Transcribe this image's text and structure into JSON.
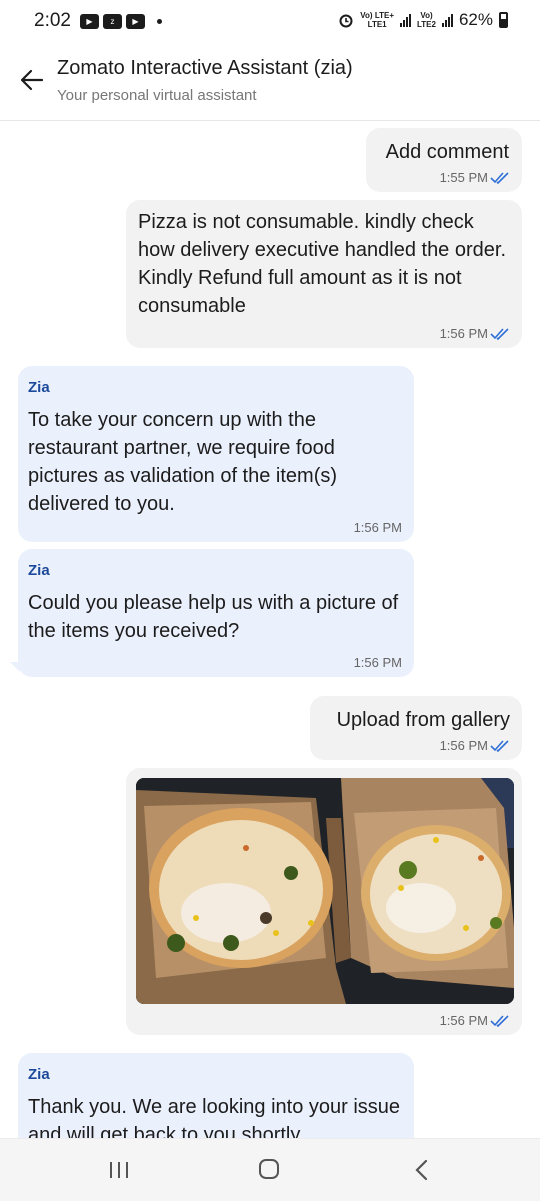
{
  "status_bar": {
    "time": "2:02",
    "network_1": "Vo) LTE+\nLTE1",
    "network_2": "Vo)\nLTE2",
    "battery": "62%"
  },
  "header": {
    "title": "Zomato Interactive Assistant (zia)",
    "subtitle": "Your personal virtual assistant"
  },
  "messages": [
    {
      "sender": "",
      "text": "Add comment",
      "time": "1:55 PM",
      "direction": "outgoing",
      "read": true
    },
    {
      "sender": "",
      "text": "Pizza is not consumable. kindly check how delivery executive handled the order. Kindly Refund full amount as it is not consumable",
      "time": "1:56 PM",
      "direction": "outgoing",
      "read": true
    },
    {
      "sender": "Zia",
      "text": "To take your concern up with the restaurant partner, we require food pictures as validation of the item(s) delivered to you.",
      "time": "1:56 PM",
      "direction": "incoming"
    },
    {
      "sender": "Zia",
      "text": "Could you please help us with a picture of the items you received?",
      "time": "1:56 PM",
      "direction": "incoming"
    },
    {
      "sender": "",
      "text": "Upload from gallery",
      "time": "1:56 PM",
      "direction": "outgoing",
      "read": true
    },
    {
      "sender": "",
      "image": "pizza-photo",
      "time": "1:56 PM",
      "direction": "outgoing",
      "read": true
    },
    {
      "sender": "Zia",
      "text": "Thank you. We are looking into your issue and will get back to you shortly.",
      "direction": "incoming"
    }
  ],
  "colors": {
    "outgoing_bubble": "#f2f2f2",
    "incoming_bubble": "#ebf0fd",
    "sender_name": "#1d4b9c",
    "read_tick": "#2f6fd6"
  },
  "navigation": {
    "recent_icon": "recent-apps-icon",
    "home_icon": "home-icon",
    "back_icon": "back-chevron-icon"
  }
}
